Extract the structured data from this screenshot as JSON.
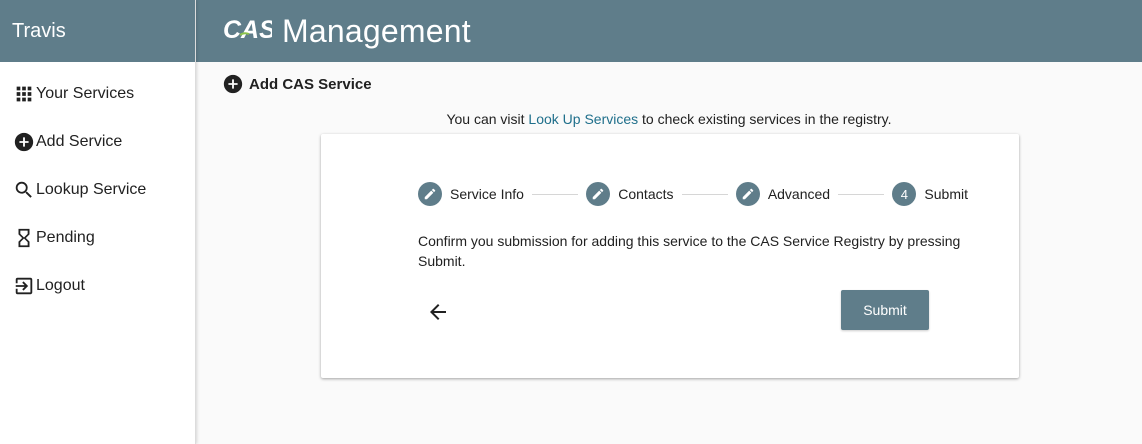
{
  "sidebar": {
    "user_name": "Travis",
    "items": [
      {
        "label": "Your Services",
        "icon": "apps-grid-icon"
      },
      {
        "label": "Add Service",
        "icon": "add-circle-icon"
      },
      {
        "label": "Lookup Service",
        "icon": "search-icon"
      },
      {
        "label": "Pending",
        "icon": "hourglass-icon"
      },
      {
        "label": "Logout",
        "icon": "logout-icon"
      }
    ]
  },
  "header": {
    "logo_text": "CAS",
    "title": "Management"
  },
  "page": {
    "heading": "Add CAS Service",
    "info_prefix": "You can visit",
    "info_link": "Look Up Services",
    "info_suffix": "to check existing services in the registry."
  },
  "stepper": {
    "steps": [
      {
        "label": "Service Info",
        "state": "complete",
        "icon": "pencil-icon"
      },
      {
        "label": "Contacts",
        "state": "complete",
        "icon": "pencil-icon"
      },
      {
        "label": "Advanced",
        "state": "complete",
        "icon": "pencil-icon"
      },
      {
        "label": "Submit",
        "state": "active",
        "number": "4"
      }
    ]
  },
  "confirm": {
    "message": "Confirm you submission for adding this service to the CAS Service Registry by pressing Submit.",
    "submit_label": "Submit"
  },
  "colors": {
    "primary": "#5f7d8a",
    "link": "#1f6f8b",
    "background": "#fafafa"
  }
}
